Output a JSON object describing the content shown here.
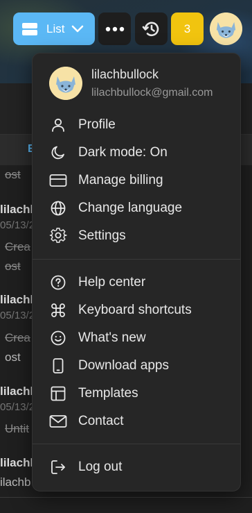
{
  "toolbar": {
    "view_label": "List",
    "notification_count": "3"
  },
  "background_list": {
    "tab_fragment": "E",
    "rows": [
      {
        "text": "ost",
        "style": "strike"
      },
      {
        "text": "lilachl",
        "style": "name"
      },
      {
        "text": "05/13/2",
        "style": "date"
      },
      {
        "text": "Crea",
        "style": "strike"
      },
      {
        "text": "ost",
        "style": "strike"
      },
      {
        "text": "lilachl",
        "style": "name"
      },
      {
        "text": "05/13/2",
        "style": "date"
      },
      {
        "text": "Crea",
        "style": "strike"
      },
      {
        "text": "ost",
        "style": "plain"
      },
      {
        "text": "lilachl",
        "style": "name"
      },
      {
        "text": "05/13/2",
        "style": "date"
      },
      {
        "text": "Untit",
        "style": "strike"
      },
      {
        "text": "lilachl",
        "style": "name"
      },
      {
        "text": "ilachb",
        "style": "plain"
      }
    ]
  },
  "menu": {
    "user": {
      "username": "lilachbullock",
      "email": "lilachbullock@gmail.com"
    },
    "group1": [
      {
        "label": "Profile",
        "icon": "user-icon"
      },
      {
        "label": "Dark mode: On",
        "icon": "moon-icon"
      },
      {
        "label": "Manage billing",
        "icon": "credit-card-icon"
      },
      {
        "label": "Change language",
        "icon": "globe-icon"
      },
      {
        "label": "Settings",
        "icon": "gear-icon"
      }
    ],
    "group2": [
      {
        "label": "Help center",
        "icon": "help-circle-icon"
      },
      {
        "label": "Keyboard shortcuts",
        "icon": "command-icon"
      },
      {
        "label": "What's new",
        "icon": "smile-icon"
      },
      {
        "label": "Download apps",
        "icon": "phone-icon"
      },
      {
        "label": "Templates",
        "icon": "layout-icon"
      },
      {
        "label": "Contact",
        "icon": "mail-icon"
      }
    ],
    "logout": {
      "label": "Log out",
      "icon": "logout-icon"
    }
  },
  "colors": {
    "accent": "#5bb8f5",
    "badge": "#f1c40f",
    "menu_bg": "#262626"
  }
}
